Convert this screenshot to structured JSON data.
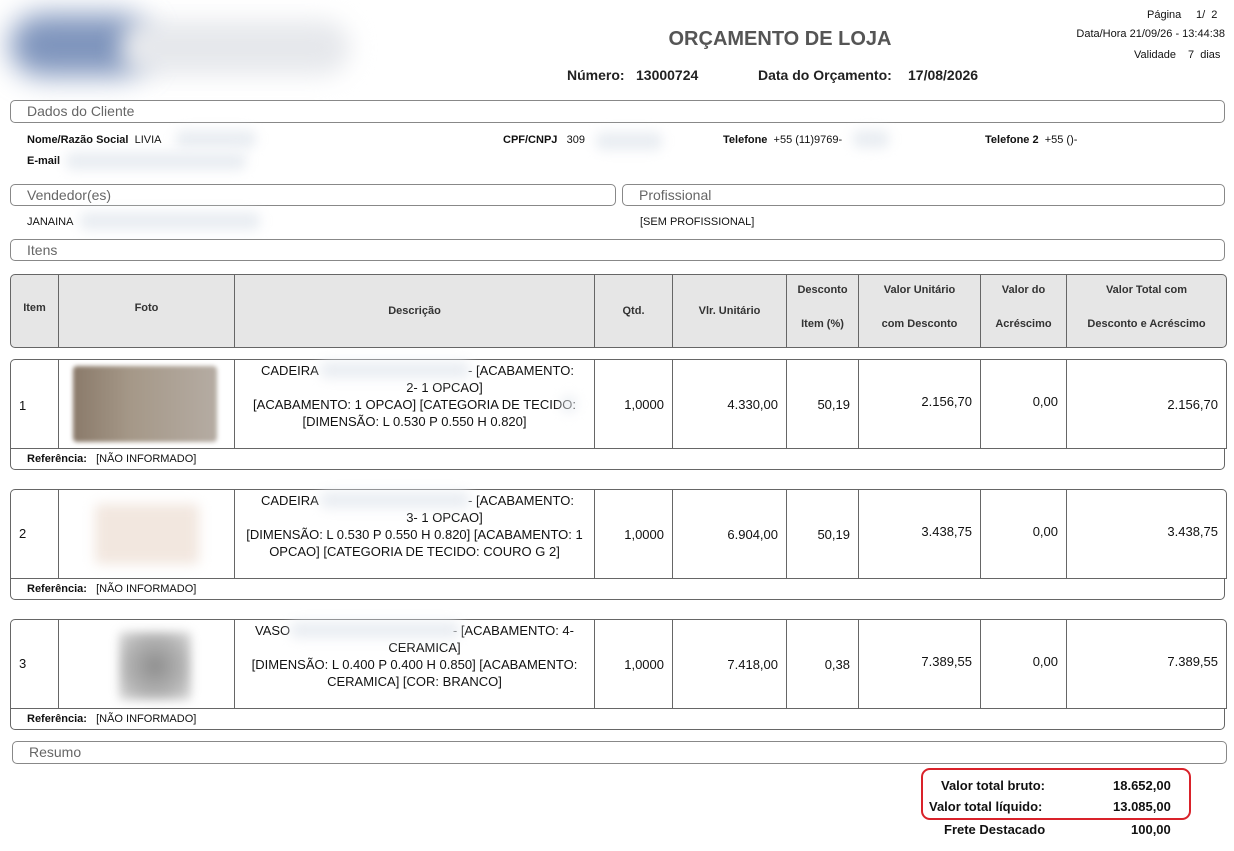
{
  "header": {
    "title": "ORÇAMENTO DE LOJA",
    "numero_label": "Número:",
    "numero": "13000724",
    "data_label": "Data do Orçamento:",
    "data": "17/08/2026",
    "pagina_label": "Página",
    "pagina": "1/  2",
    "datahora": "Data/Hora 21/09/26 - 13:44:38",
    "validade_label": "Validade",
    "validade": "7  dias"
  },
  "cliente": {
    "section": "Dados do Cliente",
    "nome_label": "Nome/Razão Social",
    "nome": "LIVIA",
    "cpf_label": "CPF/CNPJ",
    "cpf": "309",
    "tel_label": "Telefone",
    "tel": "+55 (11)9769-",
    "tel2_label": "Telefone 2",
    "tel2": "+55 ()-",
    "email_label": "E-mail"
  },
  "vendedor": {
    "section": "Vendedor(es)",
    "nome": "JANAINA"
  },
  "profissional": {
    "section": "Profissional",
    "nome": "[SEM PROFISSIONAL]"
  },
  "itens_section": "Itens",
  "table": {
    "headers": {
      "item": "Item",
      "foto": "Foto",
      "descricao": "Descrição",
      "qtd": "Qtd.",
      "vlr_unit": "Vlr. Unitário",
      "desconto_1": "Desconto",
      "desconto_2": "Item (%)",
      "vu_desc_1": "Valor Unitário",
      "vu_desc_2": "com Desconto",
      "acresc_1": "Valor do",
      "acresc_2": "Acréscimo",
      "total_1": "Valor Total com",
      "total_2": "Desconto e Acréscimo"
    },
    "rows": [
      {
        "item": "1",
        "desc_l1a": "CADEIRA",
        "desc_l1b": "- [ACABAMENTO:",
        "desc_l2": "2- 1 OPCAO]",
        "desc_l3": "[ACABAMENTO: 1 OPCAO] [CATEGORIA DE TECIDO:",
        "desc_l4": "[DIMENSÃO: L 0.530 P 0.550 H 0.820]",
        "qtd": "1,0000",
        "vlr_unit": "4.330,00",
        "desconto": "50,19",
        "vu_desc": "2.156,70",
        "acresc": "0,00",
        "total": "2.156,70",
        "ref_label": "Referência:",
        "ref": "[NÃO INFORMADO]"
      },
      {
        "item": "2",
        "desc_l1a": "CADEIRA",
        "desc_l1b": "- [ACABAMENTO:",
        "desc_l2": "3- 1 OPCAO]",
        "desc_l3": "[DIMENSÃO: L 0.530 P 0.550 H 0.820] [ACABAMENTO: 1",
        "desc_l4": "OPCAO] [CATEGORIA DE TECIDO: COURO G 2]",
        "qtd": "1,0000",
        "vlr_unit": "6.904,00",
        "desconto": "50,19",
        "vu_desc": "3.438,75",
        "acresc": "0,00",
        "total": "3.438,75",
        "ref_label": "Referência:",
        "ref": "[NÃO INFORMADO]"
      },
      {
        "item": "3",
        "desc_l1a": "VASO",
        "desc_l1b": "- [ACABAMENTO:  4-",
        "desc_l2": "CERAMICA]",
        "desc_l3": "[DIMENSÃO: L 0.400 P 0.400 H 0.850] [ACABAMENTO:",
        "desc_l4": "CERAMICA] [COR: BRANCO]",
        "qtd": "1,0000",
        "vlr_unit": "7.418,00",
        "desconto": "0,38",
        "vu_desc": "7.389,55",
        "acresc": "0,00",
        "total": "7.389,55",
        "ref_label": "Referência:",
        "ref": "[NÃO INFORMADO]"
      }
    ]
  },
  "resumo": {
    "section": "Resumo",
    "bruto_label": "Valor total bruto:",
    "bruto": "18.652,00",
    "liquido_label": "Valor total líquido:",
    "liquido": "13.085,00",
    "frete_label": "Frete Destacado",
    "frete": "100,00"
  },
  "colors": {
    "highlight_border": "#d9222a",
    "header_bg": "#e6e6e6"
  }
}
